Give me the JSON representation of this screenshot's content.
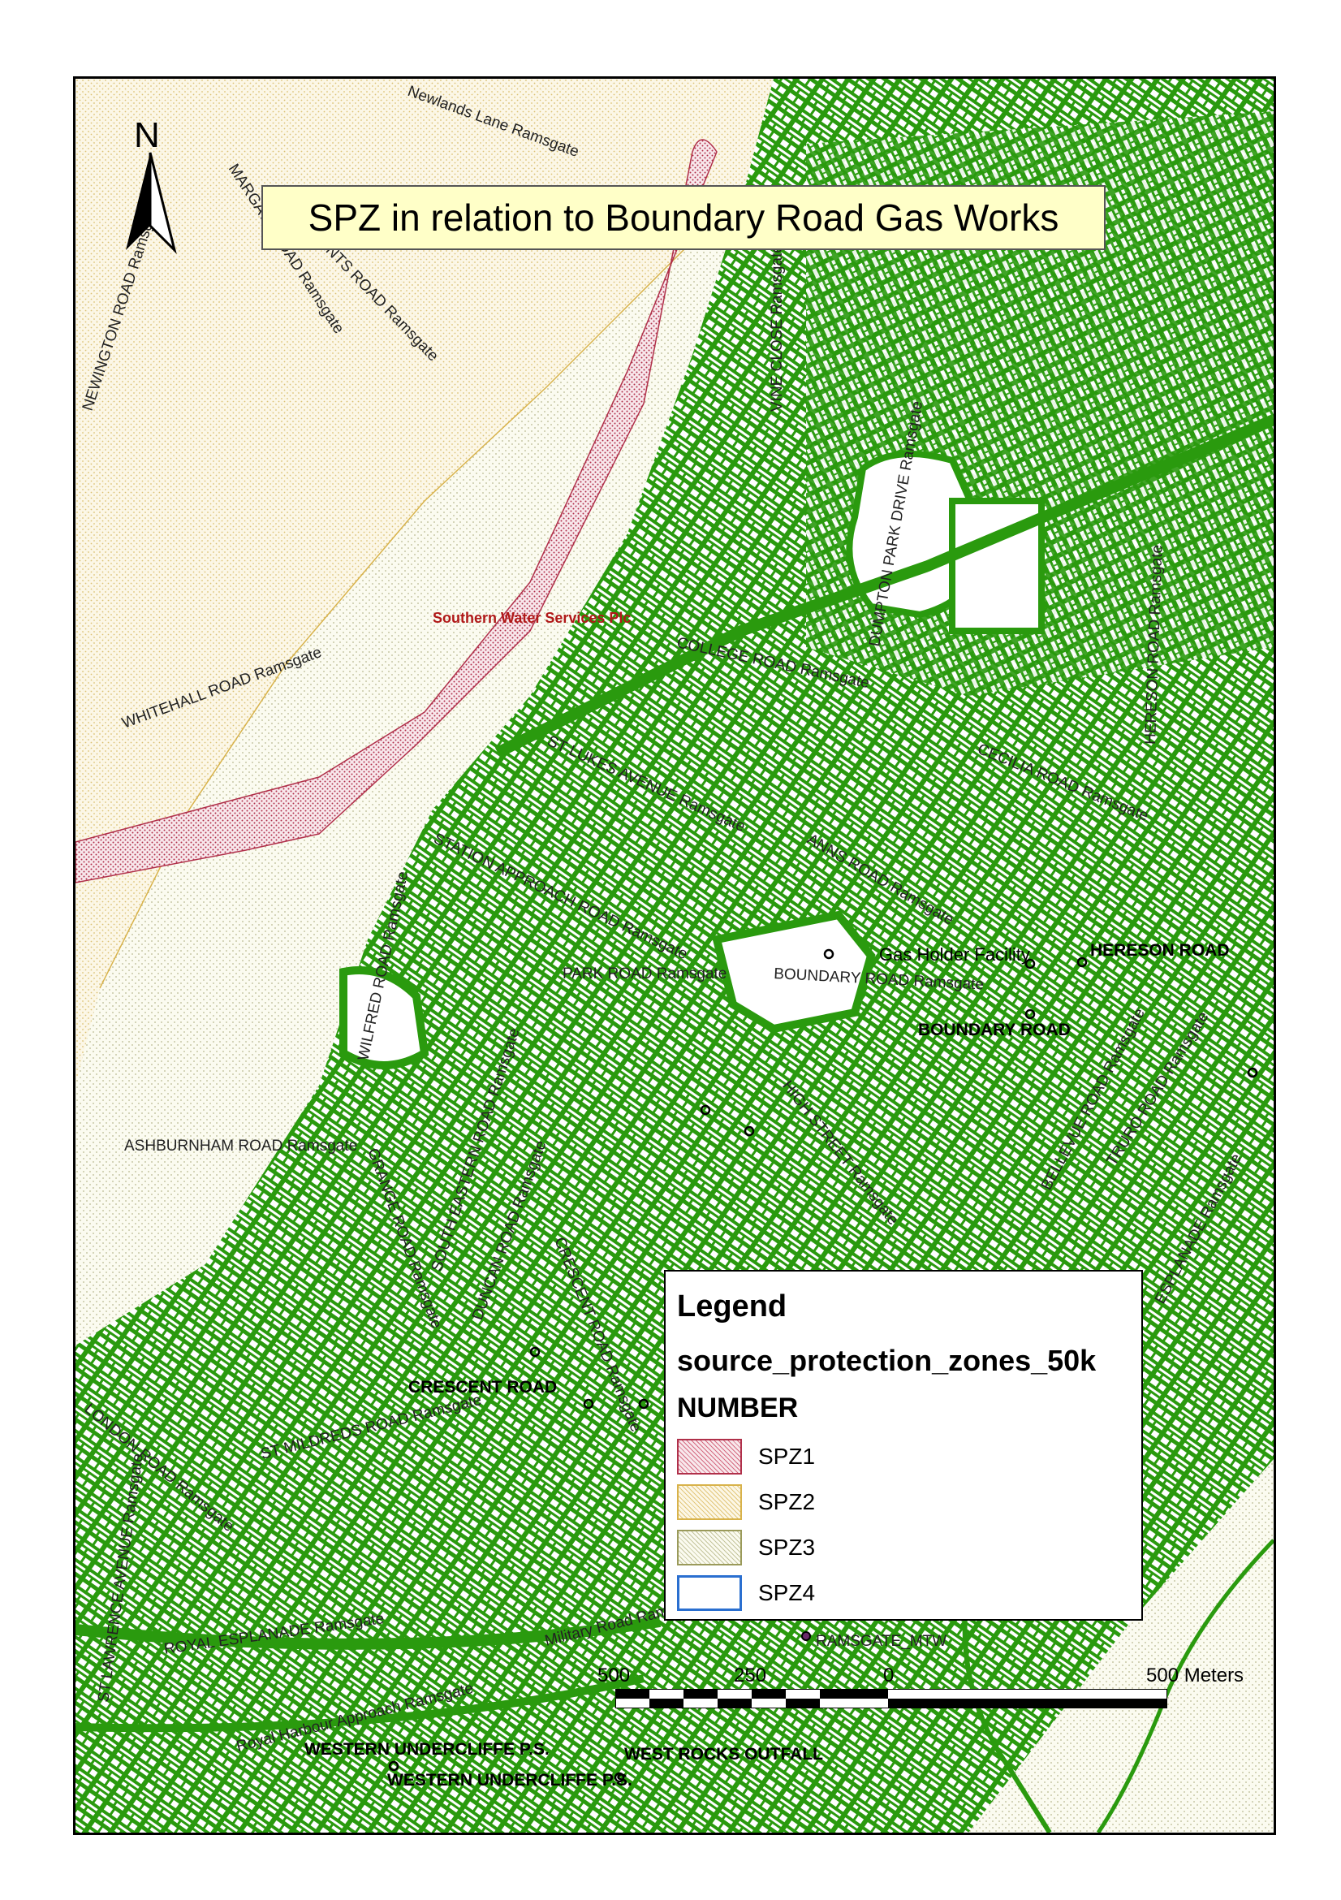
{
  "title": "SPZ in relation to Boundary Road Gas Works",
  "north_label": "N",
  "owner_label": "Southern Water Services Plc",
  "facility_label": "Gas Holder Facility",
  "road_labels": [
    "Newlands Lane Ramsgate",
    "MARGATE ROAD Ramsgate",
    "CLEMENTS ROAD Ramsgate",
    "NEWINGTON ROAD Ramsgate",
    "VINE CLOSE Ramsgate",
    "WHITEHALL ROAD Ramsgate",
    "COLLEGE ROAD Ramsgate",
    "ST LUKES AVENUE Ramsgate",
    "CECILIA ROAD Ramsgate",
    "STATION APPROACH ROAD Ramsgate",
    "ANNS ROAD Ramsgate",
    "PARK ROAD Ramsgate",
    "BOUNDARY ROAD Ramsgate",
    "WILFRED ROAD Ramsgate",
    "ASHBURNHAM ROAD Ramsgate",
    "GRANGE ROAD Ramsgate",
    "SOUTH EASTERN ROAD Ramsgate",
    "DUNCAN ROAD Ramsgate",
    "CRESCENT ROAD Ramsgate",
    "HIGH STREET Ramsgate",
    "BELLEVUE ROAD Ramsgate",
    "TRURO ROAD Ramsgate",
    "HERESON ROAD Ramsgate",
    "ST MILDREDS ROAD Ramsgate",
    "LONDON ROAD Ramsgate",
    "ST LAWRENCE AVENUE Ramsgate",
    "ROYAL ESPLANADE Ramsgate",
    "Royal Harbour Approach Ramsgate",
    "Military Road Ramsgate",
    "ESPLANADE Ramsgate",
    "DUMPTON PARK DRIVE Ramsgate"
  ],
  "site_labels": [
    "HERESON ROAD",
    "BOUNDARY ROAD",
    "CRESCENT ROAD",
    "WESTERN UNDERCLIFFE P.S.",
    "WEST ROCKS OUTFALL",
    "WESTERN UNDERCLIFFE P.S.",
    "RAMSGATE_MTW"
  ],
  "legend": {
    "title": "Legend",
    "layer": "source_protection_zones_50k",
    "field": "NUMBER",
    "items": [
      {
        "label": "SPZ1",
        "color": "#b0304a"
      },
      {
        "label": "SPZ2",
        "color": "#d8b24a"
      },
      {
        "label": "SPZ3",
        "color": "#9a9a5a"
      },
      {
        "label": "SPZ4",
        "color": "#2a6fd0"
      }
    ]
  },
  "scale_bar": {
    "ticks": [
      "500",
      "250",
      "0",
      "500 Meters"
    ]
  },
  "colors": {
    "road_network": "#2a9a0e",
    "spz1": "#b0304a",
    "spz2": "#d8b24a",
    "spz3": "#9a9a5a",
    "title_bg": "#ffffc8"
  }
}
